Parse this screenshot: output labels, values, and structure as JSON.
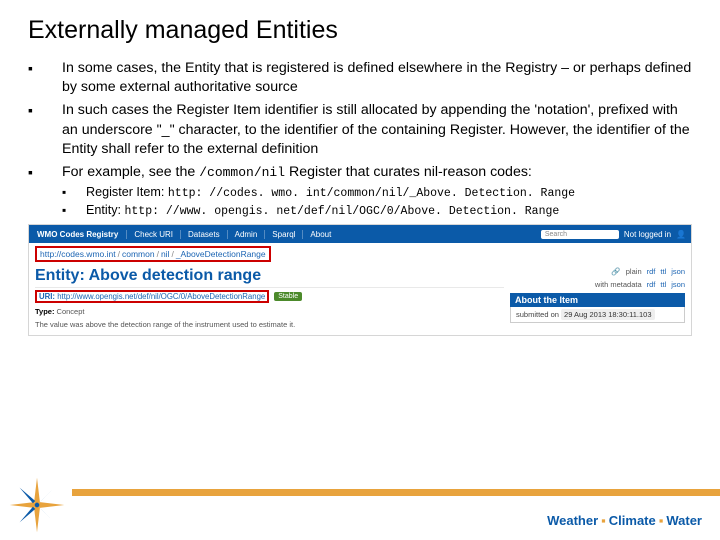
{
  "title": "Externally managed Entities",
  "b1": "In some cases, the Entity that is registered is defined elsewhere in the Registry – or perhaps defined by some external authoritative source",
  "b2a": "In such cases the Register Item identifier is still allocated by appending the 'notation', prefixed with an underscore \"_\" character, to the identifier of the containing Register. However, the identifier of the Entity shall refer to the external definition",
  "b3a": "For example, see the ",
  "b3code": "/common/nil",
  "b3b": " Register that curates nil-reason codes:",
  "s1a": "Register Item: ",
  "s1code": "http: //codes. wmo. int/common/nil/_Above. Detection. Range",
  "s2a": "Entity: ",
  "s2code": "http: //www. opengis. net/def/nil/OGC/0/Above. Detection. Range",
  "nav": {
    "brand": "WMO Codes Registry",
    "links": [
      "Check URI",
      "Datasets",
      "Admin",
      "Sparql",
      "About"
    ],
    "search": "Search",
    "login": "Not logged in"
  },
  "crumbs": {
    "root": "http://codes.wmo.int",
    "p1": "common",
    "p2": "nil",
    "p3": "_AboveDetectionRange"
  },
  "entity": {
    "title": "Entity: Above detection range",
    "uriLabel": "URI:",
    "uri": "http://www.opengis.net/def/nil/OGC/0/AboveDetectionRange",
    "stable": "Stable",
    "typeLabel": "Type:",
    "type": "Concept",
    "desc": "The value was above the detection range of the instrument used to estimate it."
  },
  "right": {
    "share": "",
    "plain": "plain",
    "rdf": "rdf",
    "ttl": "ttl",
    "json": "json",
    "with": "with metadata",
    "rdf2": "rdf",
    "ttl2": "ttl",
    "json2": "json",
    "aboutTitle": "About the Item",
    "subLabel": "submitted on",
    "subVal": "29 Aug 2013 18:30:11.103"
  },
  "footer": {
    "w": "Weather",
    "c": "Climate",
    "wa": "Water"
  }
}
